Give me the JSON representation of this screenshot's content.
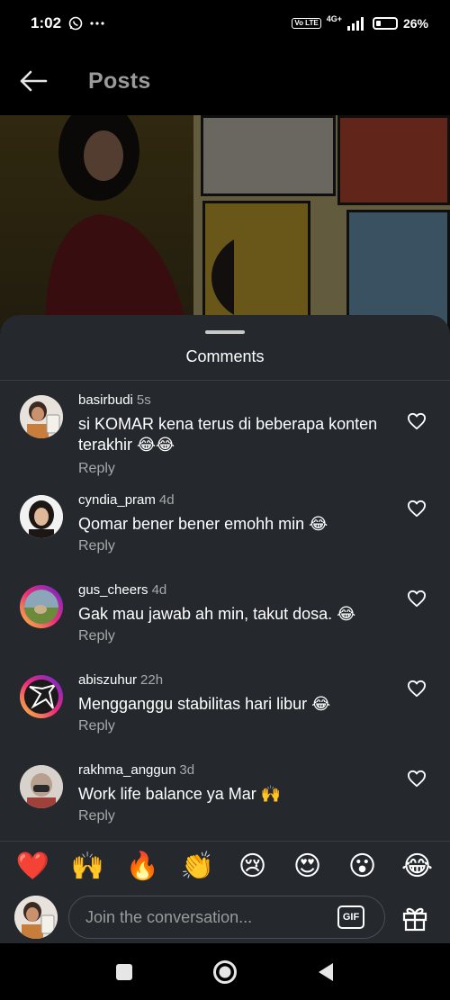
{
  "status_bar": {
    "time": "1:02",
    "network": "4G+",
    "volte": "Vo LTE",
    "battery_percent": "26%",
    "battery_level": 0.26
  },
  "header": {
    "title": "Posts",
    "back_icon": "arrow-left-icon"
  },
  "sheet": {
    "title": "Comments"
  },
  "comments": [
    {
      "username": "basirbudi",
      "time": "5s",
      "text": "si KOMAR kena terus di beberapa konten terakhir 😂😂",
      "reply": "Reply"
    },
    {
      "username": "cyndia_pram",
      "time": "4d",
      "text": "Qomar bener bener emohh min 😂",
      "reply": "Reply"
    },
    {
      "username": "gus_cheers",
      "time": "4d",
      "text": "Gak mau jawab ah min, takut dosa. 😂",
      "reply": "Reply"
    },
    {
      "username": "abiszuhur",
      "time": "22h",
      "text": "Mengganggu stabilitas hari libur 😂",
      "reply": "Reply"
    },
    {
      "username": "rakhma_anggun",
      "time": "3d",
      "text": "Work life balance ya Mar 🙌",
      "reply": "Reply"
    }
  ],
  "emoji_bar": [
    "❤️",
    "🙌",
    "🔥",
    "👏",
    "😢",
    "😍",
    "😮",
    "😂"
  ],
  "composer": {
    "placeholder": "Join the conversation...",
    "gif_label": "GIF"
  },
  "colors": {
    "sheet_bg": "#25292e",
    "secondary_text": "#a8a8a8"
  }
}
